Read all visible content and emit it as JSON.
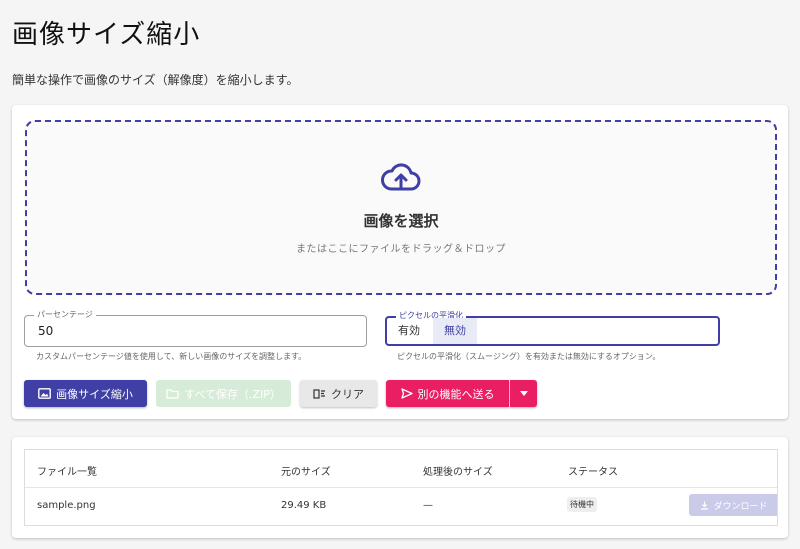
{
  "page": {
    "title": "画像サイズ縮小",
    "description": "簡単な操作で画像のサイズ（解像度）を縮小します。"
  },
  "upload": {
    "title": "画像を選択",
    "subtitle": "またはここにファイルをドラッグ＆ドロップ"
  },
  "percent": {
    "legend": "パーセンテージ",
    "value": "50",
    "helper": "カスタムパーセンテージ値を使用して、新しい画像のサイズを調整します。"
  },
  "smoothing": {
    "legend": "ピクセルの平滑化",
    "on_label": "有効",
    "off_label": "無効",
    "selected": "無効",
    "helper": "ピクセルの平滑化（スムージング）を有効または無効にするオプション。"
  },
  "actions": {
    "resize_label": "画像サイズ縮小",
    "save_all_label": "すべて保存（.ZIP）",
    "clear_label": "クリア",
    "send_label": "別の機能へ送る"
  },
  "table": {
    "headers": [
      "ファイル一覧",
      "元のサイズ",
      "処理後のサイズ",
      "ステータス"
    ],
    "rows": [
      {
        "name": "sample.png",
        "original_size": "29.49 KB",
        "processed_size": "—",
        "status": "待機中",
        "download_label": "ダウンロード"
      }
    ]
  },
  "colors": {
    "primary": "#3f3fa5",
    "accent": "#e91e63",
    "save_disabled": "#d6ecd8",
    "download_disabled": "#c9cbe9"
  }
}
